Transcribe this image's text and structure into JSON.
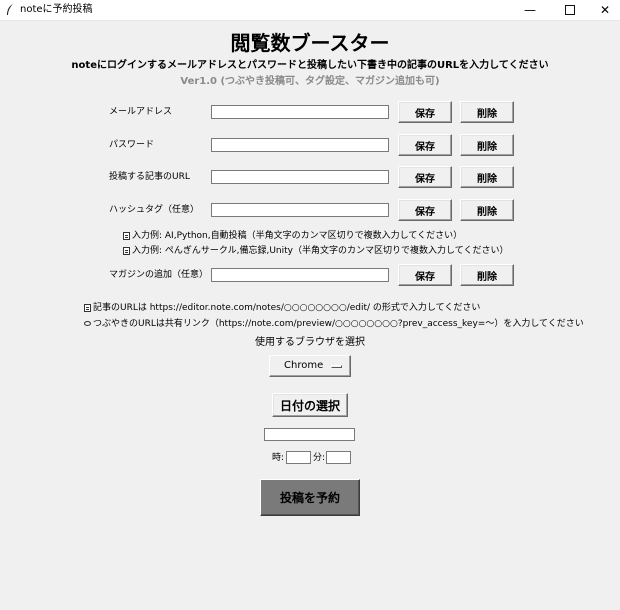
{
  "window": {
    "title": "noteに予約投稿",
    "icon": "feather-pen-icon",
    "controls": {
      "minimize": "—",
      "close": "✕"
    }
  },
  "header": {
    "title": "閲覧数ブースター",
    "subtitle": "noteにログインするメールアドレスとパスワードと投稿したい下書き中の記事のURLを入力してください",
    "version": "Ver1.0 (つぶやき投稿可、タグ設定、マガジン追加も可)"
  },
  "form": {
    "save_label": "保存",
    "delete_label": "削除",
    "email": {
      "label": "メールアドレス",
      "value": ""
    },
    "password": {
      "label": "パスワード",
      "value": ""
    },
    "url": {
      "label": "投稿する記事のURL",
      "value": ""
    },
    "hashtag": {
      "label": "ハッシュタグ（任意）",
      "value": ""
    },
    "hashtag_examples": [
      "入力例: AI,Python,自動投稿（半角文字のカンマ区切りで複数入力してください）",
      "入力例: ぺんぎんサークル,備忘録,Unity（半角文字のカンマ区切りで複数入力してください）"
    ],
    "magazine": {
      "label": "マガジンの追加（任意）",
      "value": ""
    }
  },
  "notes": {
    "article_url": "記事のURLは https://editor.note.com/notes/○○○○○○○○/edit/ の形式で入力してください",
    "tweet_url": "つぶやきのURLは共有リンク（https://note.com/preview/○○○○○○○○?prev_access_key=〜）を入力してください"
  },
  "browser": {
    "label": "使用するブラウザを選択",
    "selected": "Chrome"
  },
  "schedule": {
    "date_button": "日付の選択",
    "date_value": "",
    "hour_label": "時:",
    "minute_label": "分:",
    "hour_value": "",
    "minute_value": ""
  },
  "submit_label": "投稿を予約",
  "colors": {
    "background": "#f0f0f0",
    "submit_bg": "#7a7a7a",
    "version_text": "#8a8a8a"
  }
}
